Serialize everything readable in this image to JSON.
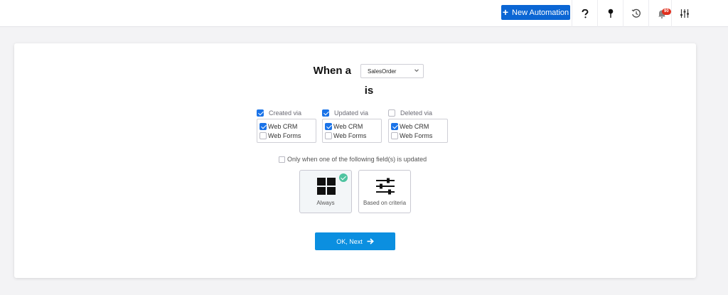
{
  "topbar": {
    "new_automation_label": "New Automation",
    "icons": [
      "help-icon",
      "pin-icon",
      "history-icon",
      "bell-icon",
      "sliders-icon"
    ],
    "notification_count": "90",
    "colors": {
      "primary_button": "#0b66d4",
      "badge": "#e0301e"
    }
  },
  "rule": {
    "when_label": "When a",
    "module_value": "SalesOrder",
    "is_label": "is"
  },
  "triggers": [
    {
      "label": "Created via",
      "checked": true,
      "options": [
        {
          "label": "Web CRM",
          "checked": true
        },
        {
          "label": "Web Forms",
          "checked": false
        }
      ]
    },
    {
      "label": "Updated via",
      "checked": true,
      "options": [
        {
          "label": "Web CRM",
          "checked": true
        },
        {
          "label": "Web Forms",
          "checked": false
        }
      ]
    },
    {
      "label": "Deleted via",
      "checked": false,
      "options": [
        {
          "label": "Web CRM",
          "checked": true
        },
        {
          "label": "Web Forms",
          "checked": false
        }
      ]
    }
  ],
  "only_when_label": "Only when one of the following field(s) is updated",
  "execution": {
    "always_label": "Always",
    "criteria_label": "Based on criteria",
    "selected": "Always"
  },
  "ok_next_label": "OK, Next",
  "colors": {
    "ok_button": "#0b8fe0",
    "checkbox": "#1a73e8",
    "selected_tick": "#4ec3a0"
  }
}
